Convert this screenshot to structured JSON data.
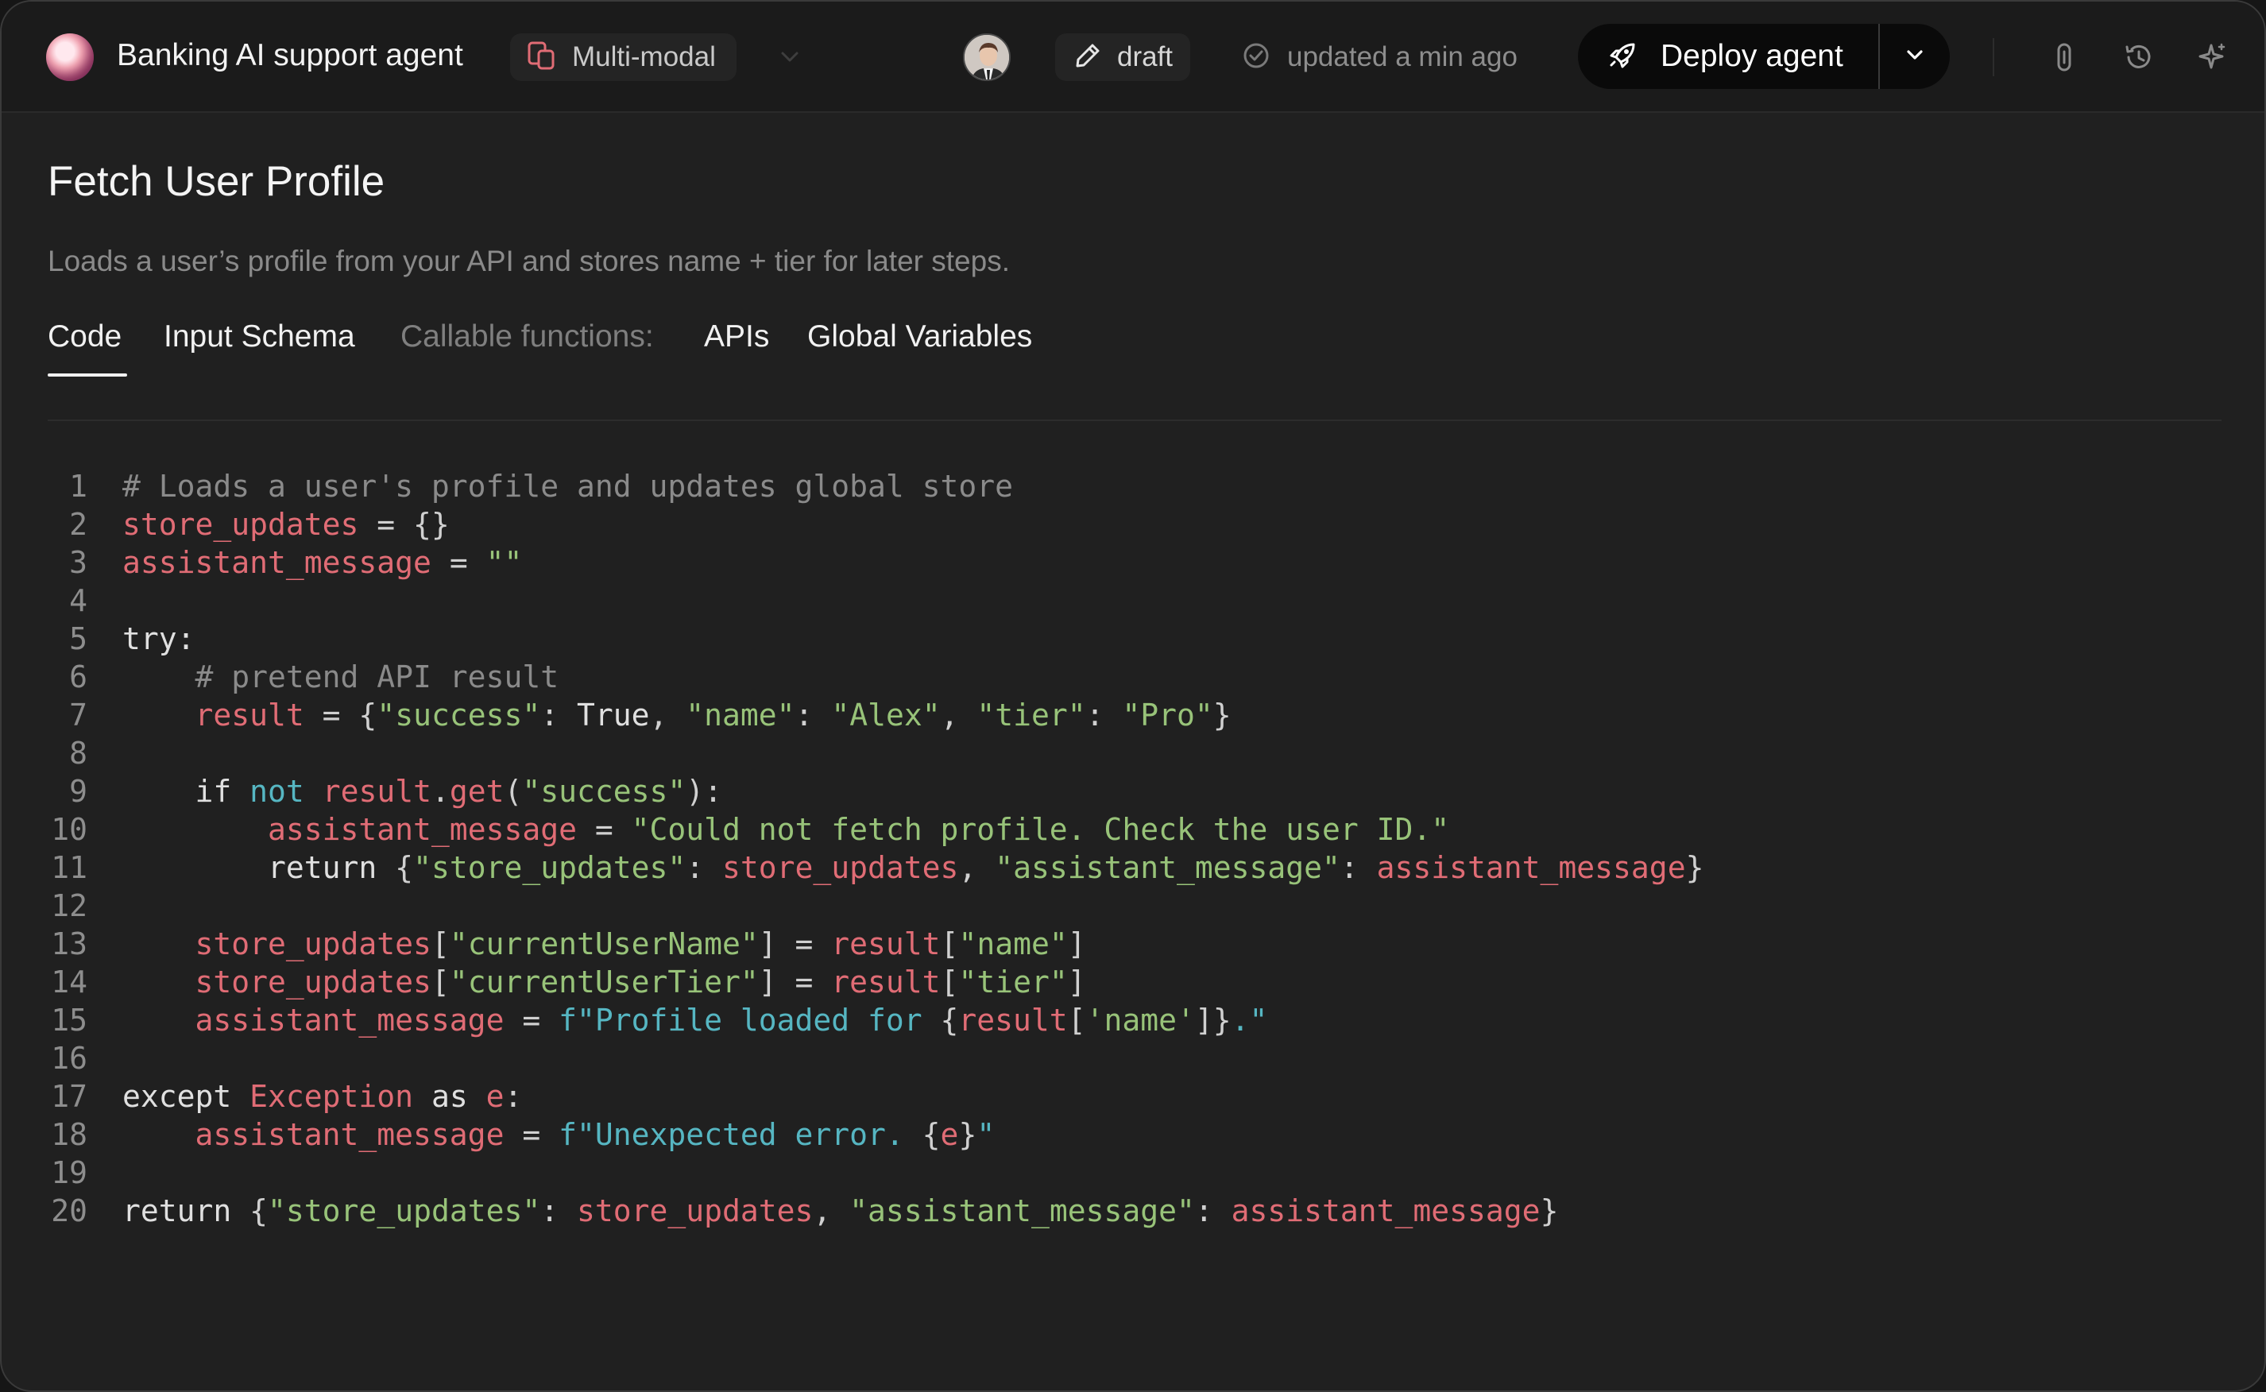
{
  "header": {
    "app_title": "Banking AI support agent",
    "mode_label": "Multi-modal",
    "draft_label": "draft",
    "status_label": "updated a min ago",
    "deploy_label": "Deploy agent"
  },
  "page": {
    "title": "Fetch User Profile",
    "description": "Loads a user’s profile from your API and stores name + tier for later steps."
  },
  "tabs": {
    "code": "Code",
    "input_schema": "Input Schema",
    "callable_label": "Callable functions:",
    "apis": "APIs",
    "global_variables": "Global Variables"
  },
  "colors": {
    "accent_red": "#e06c75",
    "string_green": "#98c379",
    "comment_gray": "#8a8a8a",
    "keyword_cyan": "#56b6c2",
    "deploy_bg": "#0a0a0a"
  },
  "icons": [
    "logo",
    "multimodal-icon",
    "chevron-down-icon",
    "avatar",
    "pencil-icon",
    "check-circle-icon",
    "rocket-icon",
    "link-icon",
    "history-icon",
    "sparkle-icon"
  ],
  "code": {
    "line_numbers": [
      "1",
      "2",
      "3",
      "4",
      "5",
      "6",
      "7",
      "8",
      "9",
      "10",
      "11",
      "12",
      "13",
      "14",
      "15",
      "16",
      "17",
      "18",
      "19",
      "20"
    ],
    "lines": [
      [
        [
          "c",
          "# Loads a user's profile and updates global store"
        ]
      ],
      [
        [
          "v",
          "store_updates"
        ],
        [
          "p",
          " = {}"
        ]
      ],
      [
        [
          "v",
          "assistant_message"
        ],
        [
          "p",
          " = "
        ],
        [
          "s",
          "\"\""
        ]
      ],
      [],
      [
        [
          "k",
          "try:"
        ]
      ],
      [
        [
          "k",
          "    "
        ],
        [
          "c",
          "# pretend API result"
        ]
      ],
      [
        [
          "k",
          "    "
        ],
        [
          "v",
          "result"
        ],
        [
          "p",
          " = {"
        ],
        [
          "s",
          "\"success\""
        ],
        [
          "p",
          ": "
        ],
        [
          "k",
          "True"
        ],
        [
          "p",
          ", "
        ],
        [
          "s",
          "\"name\""
        ],
        [
          "p",
          ": "
        ],
        [
          "s",
          "\"Alex\""
        ],
        [
          "p",
          ", "
        ],
        [
          "s",
          "\"tier\""
        ],
        [
          "p",
          ": "
        ],
        [
          "s",
          "\"Pro\""
        ],
        [
          "p",
          "}"
        ]
      ],
      [],
      [
        [
          "k",
          "    if "
        ],
        [
          "b",
          "not"
        ],
        [
          "k",
          " "
        ],
        [
          "v",
          "result"
        ],
        [
          "p",
          "."
        ],
        [
          "v",
          "get"
        ],
        [
          "p",
          "("
        ],
        [
          "s",
          "\"success\""
        ],
        [
          "p",
          "):"
        ]
      ],
      [
        [
          "k",
          "        "
        ],
        [
          "v",
          "assistant_message"
        ],
        [
          "p",
          " = "
        ],
        [
          "s",
          "\"Could not fetch profile. Check the user ID.\""
        ]
      ],
      [
        [
          "k",
          "        return "
        ],
        [
          "p",
          "{"
        ],
        [
          "s",
          "\"store_updates\""
        ],
        [
          "p",
          ": "
        ],
        [
          "v",
          "store_updates"
        ],
        [
          "p",
          ", "
        ],
        [
          "s",
          "\"assistant_message\""
        ],
        [
          "p",
          ": "
        ],
        [
          "v",
          "assistant_message"
        ],
        [
          "p",
          "}"
        ]
      ],
      [],
      [
        [
          "k",
          "    "
        ],
        [
          "v",
          "store_updates"
        ],
        [
          "p",
          "["
        ],
        [
          "s",
          "\"currentUserName\""
        ],
        [
          "p",
          "] = "
        ],
        [
          "v",
          "result"
        ],
        [
          "p",
          "["
        ],
        [
          "s",
          "\"name\""
        ],
        [
          "p",
          "]"
        ]
      ],
      [
        [
          "k",
          "    "
        ],
        [
          "v",
          "store_updates"
        ],
        [
          "p",
          "["
        ],
        [
          "s",
          "\"currentUserTier\""
        ],
        [
          "p",
          "] = "
        ],
        [
          "v",
          "result"
        ],
        [
          "p",
          "["
        ],
        [
          "s",
          "\"tier\""
        ],
        [
          "p",
          "]"
        ]
      ],
      [
        [
          "k",
          "    "
        ],
        [
          "v",
          "assistant_message"
        ],
        [
          "p",
          " = "
        ],
        [
          "b",
          "f\"Profile loaded for "
        ],
        [
          "p",
          "{"
        ],
        [
          "v",
          "result"
        ],
        [
          "p",
          "["
        ],
        [
          "s",
          "'name'"
        ],
        [
          "p",
          "]}"
        ],
        [
          "b",
          ".\""
        ]
      ],
      [],
      [
        [
          "k",
          "except "
        ],
        [
          "v",
          "Exception"
        ],
        [
          "k",
          " as "
        ],
        [
          "v",
          "e"
        ],
        [
          "p",
          ":"
        ]
      ],
      [
        [
          "k",
          "    "
        ],
        [
          "v",
          "assistant_message"
        ],
        [
          "p",
          " = "
        ],
        [
          "b",
          "f\"Unexpected error. "
        ],
        [
          "p",
          "{"
        ],
        [
          "v",
          "e"
        ],
        [
          "p",
          "}"
        ],
        [
          "b",
          "\""
        ]
      ],
      [],
      [
        [
          "k",
          "return "
        ],
        [
          "p",
          "{"
        ],
        [
          "s",
          "\"store_updates\""
        ],
        [
          "p",
          ": "
        ],
        [
          "v",
          "store_updates"
        ],
        [
          "p",
          ", "
        ],
        [
          "s",
          "\"assistant_message\""
        ],
        [
          "p",
          ": "
        ],
        [
          "v",
          "assistant_message"
        ],
        [
          "p",
          "}"
        ]
      ]
    ]
  }
}
